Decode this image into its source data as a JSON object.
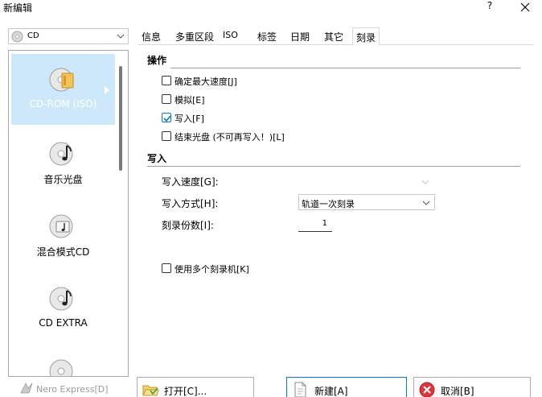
{
  "window": {
    "title": "新编辑",
    "help_label": "?"
  },
  "cd_select": {
    "value": "CD"
  },
  "disc_types": [
    {
      "label": "CD-ROM (ISO)",
      "selected": true
    },
    {
      "label": "音乐光盘"
    },
    {
      "label": "混合模式CD"
    },
    {
      "label": "CD EXTRA"
    }
  ],
  "tabs": [
    "信息",
    "多重区段",
    "ISO",
    "标签",
    "日期",
    "其它",
    "刻录"
  ],
  "active_tab": "刻录",
  "sections": {
    "action": {
      "title": "操作",
      "checkboxes": [
        {
          "label": "确定最大速度[J]",
          "checked": false
        },
        {
          "label": "模拟[E]",
          "checked": false
        },
        {
          "label": "写入[F]",
          "checked": true
        },
        {
          "label": "结束光盘 (不可再写入！)[L]",
          "checked": false
        }
      ]
    },
    "write": {
      "title": "写入",
      "speed_label": "写入速度[G]:",
      "mode_label": "写入方式[H]:",
      "mode_value": "轨道一次刻录",
      "copies_label": "刻录份数[I]:",
      "copies_value": "1",
      "multi_recorder_label": "使用多个刻录机[K]"
    }
  },
  "buttons": {
    "nero_express": "Nero Express[D]",
    "open": "打开[C]...",
    "new": "新建[A]",
    "cancel": "取消[B]"
  },
  "colors": {
    "selection_bg": "#cde8fa",
    "check_accent": "#0078d7",
    "cancel_red": "#e0333b"
  }
}
